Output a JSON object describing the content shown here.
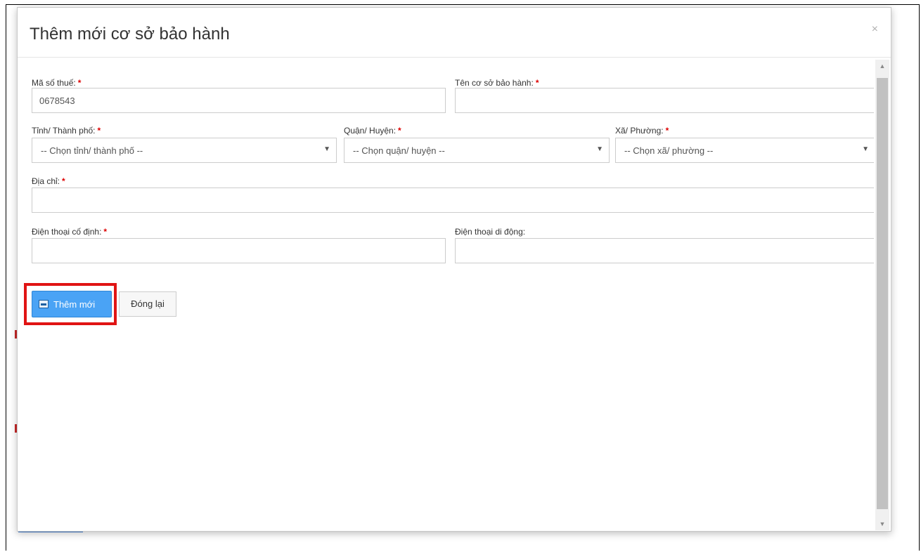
{
  "modal": {
    "title": "Thêm mới cơ sở bảo hành",
    "close_glyph": "×"
  },
  "form": {
    "tax_code": {
      "label": "Mã số thuế:",
      "required": "*",
      "value": "0678543"
    },
    "center_name": {
      "label": "Tên cơ sở bảo hành:",
      "required": "*",
      "value": ""
    },
    "province": {
      "label": "Tỉnh/ Thành phố:",
      "required": "*",
      "selected": "-- Chọn tỉnh/ thành phố --"
    },
    "district": {
      "label": "Quận/ Huyện:",
      "required": "*",
      "selected": "-- Chọn quận/ huyện --"
    },
    "ward": {
      "label": "Xã/ Phường:",
      "required": "*",
      "selected": "-- Chọn xã/ phường --"
    },
    "address": {
      "label": "Địa chỉ:",
      "required": "*",
      "value": ""
    },
    "landline": {
      "label": "Điện thoại cố định:",
      "required": "*",
      "value": ""
    },
    "mobile": {
      "label": "Điện thoại di động:",
      "value": ""
    }
  },
  "buttons": {
    "add_label": "Thêm mới",
    "close_label": "Đóng lại"
  },
  "colors": {
    "primary": "#4aa3f5",
    "required": "#dd0000",
    "highlight": "#e01414"
  }
}
